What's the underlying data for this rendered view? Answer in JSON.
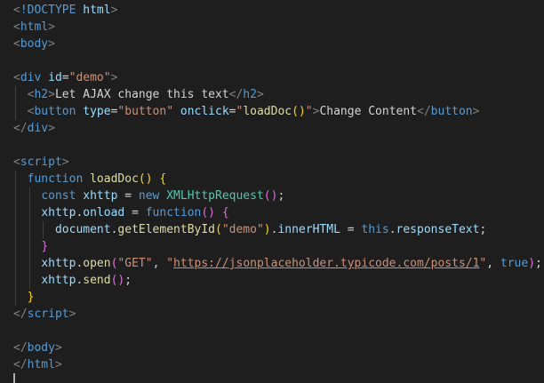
{
  "editor": {
    "lines": [
      [
        {
          "t": "<",
          "c": "punct"
        },
        {
          "t": "!DOCTYPE",
          "c": "tag"
        },
        {
          "t": " html",
          "c": "attr"
        },
        {
          "t": ">",
          "c": "punct"
        }
      ],
      [
        {
          "t": "<",
          "c": "punct"
        },
        {
          "t": "html",
          "c": "tag"
        },
        {
          "t": ">",
          "c": "punct"
        }
      ],
      [
        {
          "t": "<",
          "c": "punct"
        },
        {
          "t": "body",
          "c": "tag"
        },
        {
          "t": ">",
          "c": "punct"
        }
      ],
      [],
      [
        {
          "t": "<",
          "c": "punct"
        },
        {
          "t": "div",
          "c": "tag"
        },
        {
          "t": " ",
          "c": "text"
        },
        {
          "t": "id",
          "c": "attr"
        },
        {
          "t": "=",
          "c": "text"
        },
        {
          "t": "\"demo\"",
          "c": "str"
        },
        {
          "t": ">",
          "c": "punct"
        }
      ],
      [
        {
          "t": "  ",
          "c": "text"
        },
        {
          "t": "<",
          "c": "punct"
        },
        {
          "t": "h2",
          "c": "tag"
        },
        {
          "t": ">",
          "c": "punct"
        },
        {
          "t": "Let AJAX change this text",
          "c": "text"
        },
        {
          "t": "</",
          "c": "punct"
        },
        {
          "t": "h2",
          "c": "tag"
        },
        {
          "t": ">",
          "c": "punct"
        }
      ],
      [
        {
          "t": "  ",
          "c": "text"
        },
        {
          "t": "<",
          "c": "punct"
        },
        {
          "t": "button",
          "c": "tag"
        },
        {
          "t": " ",
          "c": "text"
        },
        {
          "t": "type",
          "c": "attr"
        },
        {
          "t": "=",
          "c": "text"
        },
        {
          "t": "\"button\"",
          "c": "str"
        },
        {
          "t": " ",
          "c": "text"
        },
        {
          "t": "onclick",
          "c": "attr"
        },
        {
          "t": "=",
          "c": "text"
        },
        {
          "t": "\"",
          "c": "str"
        },
        {
          "t": "loadDoc",
          "c": "func"
        },
        {
          "t": "()",
          "c": "bracket1"
        },
        {
          "t": "\"",
          "c": "str"
        },
        {
          "t": ">",
          "c": "punct"
        },
        {
          "t": "Change Content",
          "c": "text"
        },
        {
          "t": "</",
          "c": "punct"
        },
        {
          "t": "button",
          "c": "tag"
        },
        {
          "t": ">",
          "c": "punct"
        }
      ],
      [
        {
          "t": "</",
          "c": "punct"
        },
        {
          "t": "div",
          "c": "tag"
        },
        {
          "t": ">",
          "c": "punct"
        }
      ],
      [],
      [
        {
          "t": "<",
          "c": "punct"
        },
        {
          "t": "script",
          "c": "tag"
        },
        {
          "t": ">",
          "c": "punct"
        }
      ],
      [
        {
          "t": "  ",
          "c": "text"
        },
        {
          "t": "function",
          "c": "keyword"
        },
        {
          "t": " ",
          "c": "text"
        },
        {
          "t": "loadDoc",
          "c": "func"
        },
        {
          "t": "()",
          "c": "bracket1"
        },
        {
          "t": " ",
          "c": "text"
        },
        {
          "t": "{",
          "c": "bracket1"
        }
      ],
      [
        {
          "t": "    ",
          "c": "text"
        },
        {
          "t": "const",
          "c": "keyword"
        },
        {
          "t": " ",
          "c": "text"
        },
        {
          "t": "xhttp",
          "c": "var"
        },
        {
          "t": " = ",
          "c": "op"
        },
        {
          "t": "new",
          "c": "keyword"
        },
        {
          "t": " ",
          "c": "text"
        },
        {
          "t": "XMLHttpRequest",
          "c": "class"
        },
        {
          "t": "()",
          "c": "bracket2"
        },
        {
          "t": ";",
          "c": "text"
        }
      ],
      [
        {
          "t": "    ",
          "c": "text"
        },
        {
          "t": "xhttp",
          "c": "var"
        },
        {
          "t": ".",
          "c": "text"
        },
        {
          "t": "onload",
          "c": "var"
        },
        {
          "t": " = ",
          "c": "op"
        },
        {
          "t": "function",
          "c": "keyword"
        },
        {
          "t": "()",
          "c": "bracket2"
        },
        {
          "t": " ",
          "c": "text"
        },
        {
          "t": "{",
          "c": "bracket2"
        }
      ],
      [
        {
          "t": "      ",
          "c": "text"
        },
        {
          "t": "document",
          "c": "var"
        },
        {
          "t": ".",
          "c": "text"
        },
        {
          "t": "getElementById",
          "c": "func"
        },
        {
          "t": "(",
          "c": "bracket1"
        },
        {
          "t": "\"demo\"",
          "c": "str"
        },
        {
          "t": ")",
          "c": "bracket1"
        },
        {
          "t": ".",
          "c": "text"
        },
        {
          "t": "innerHTML",
          "c": "var"
        },
        {
          "t": " = ",
          "c": "op"
        },
        {
          "t": "this",
          "c": "keyword"
        },
        {
          "t": ".",
          "c": "text"
        },
        {
          "t": "responseText",
          "c": "var"
        },
        {
          "t": ";",
          "c": "text"
        }
      ],
      [
        {
          "t": "    ",
          "c": "text"
        },
        {
          "t": "}",
          "c": "bracket2"
        }
      ],
      [
        {
          "t": "    ",
          "c": "text"
        },
        {
          "t": "xhttp",
          "c": "var"
        },
        {
          "t": ".",
          "c": "text"
        },
        {
          "t": "open",
          "c": "func"
        },
        {
          "t": "(",
          "c": "bracket2"
        },
        {
          "t": "\"GET\"",
          "c": "str"
        },
        {
          "t": ", ",
          "c": "text"
        },
        {
          "t": "\"",
          "c": "str"
        },
        {
          "t": "https://jsonplaceholder.typicode.com/posts/1",
          "c": "link"
        },
        {
          "t": "\"",
          "c": "str"
        },
        {
          "t": ", ",
          "c": "text"
        },
        {
          "t": "true",
          "c": "keyword"
        },
        {
          "t": ")",
          "c": "bracket2"
        },
        {
          "t": ";",
          "c": "text"
        }
      ],
      [
        {
          "t": "    ",
          "c": "text"
        },
        {
          "t": "xhttp",
          "c": "var"
        },
        {
          "t": ".",
          "c": "text"
        },
        {
          "t": "send",
          "c": "func"
        },
        {
          "t": "()",
          "c": "bracket2"
        },
        {
          "t": ";",
          "c": "text"
        }
      ],
      [
        {
          "t": "  ",
          "c": "text"
        },
        {
          "t": "}",
          "c": "bracket1"
        }
      ],
      [
        {
          "t": "</",
          "c": "punct"
        },
        {
          "t": "script",
          "c": "tag"
        },
        {
          "t": ">",
          "c": "punct"
        }
      ],
      [],
      [
        {
          "t": "</",
          "c": "punct"
        },
        {
          "t": "body",
          "c": "tag"
        },
        {
          "t": ">",
          "c": "punct"
        }
      ],
      [
        {
          "t": "</",
          "c": "punct"
        },
        {
          "t": "html",
          "c": "tag"
        },
        {
          "t": ">",
          "c": "punct"
        }
      ],
      []
    ],
    "colors": {
      "background": "#1e1e1e",
      "tag": "#569cd6",
      "attr": "#9cdcfe",
      "string": "#ce9178",
      "function": "#dcdcaa",
      "class": "#4ec9b0",
      "bracket_level1": "#ffd700",
      "bracket_level2": "#da70d6",
      "punctuation": "#808080",
      "text": "#d4d4d4"
    }
  }
}
